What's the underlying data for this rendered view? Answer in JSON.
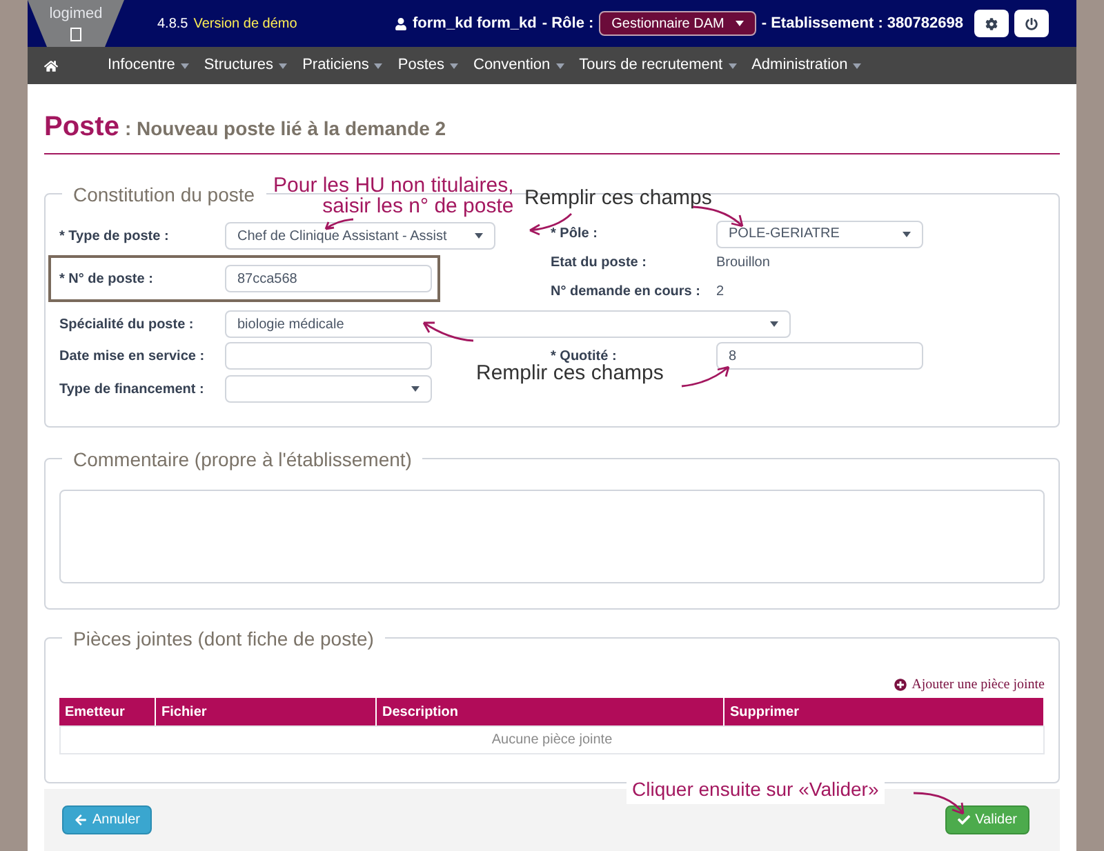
{
  "header": {
    "logo": "logimed",
    "version": "4.8.5",
    "edition": "Version de démo",
    "user": "form_kd form_kd",
    "role_label": "- Rôle :",
    "role": "Gestionnaire DAM",
    "establishment": "- Etablissement : 380782698"
  },
  "nav": [
    {
      "label": "Infocentre"
    },
    {
      "label": "Structures"
    },
    {
      "label": "Praticiens"
    },
    {
      "label": "Postes"
    },
    {
      "label": "Convention"
    },
    {
      "label": "Tours de recrutement"
    },
    {
      "label": "Administration"
    }
  ],
  "title": "Poste",
  "subtitle": ": Nouveau poste lié à la demande 2",
  "constitution": {
    "legend": "Constitution du poste",
    "left": [
      {
        "label": "* Type de poste :",
        "kind": "select",
        "value": "Chef de Clinique Assistant - Assist",
        "highlighted": false
      },
      {
        "label": "* N° de poste :",
        "kind": "input",
        "value": "87cca568",
        "highlighted": true
      }
    ],
    "right": [
      {
        "label": "* Pôle :",
        "kind": "select",
        "value": "POLE-GERIATRE"
      },
      {
        "label": "Etat du poste :",
        "kind": "text",
        "value": "Brouillon"
      },
      {
        "label": "N° demande en cours :",
        "kind": "text",
        "value": "2"
      }
    ],
    "speciality": {
      "label": "Spécialité du poste :",
      "value": "biologie médicale"
    },
    "left2": [
      {
        "label": "Date mise en service :",
        "kind": "input"
      },
      {
        "label": "Type de financement :",
        "kind": "select"
      }
    ],
    "quotity": {
      "label": "* Quotité :",
      "value": "8"
    }
  },
  "comment": {
    "legend": "Commentaire (propre à l'établissement)"
  },
  "attachments": {
    "legend": "Pièces jointes (dont fiche de poste)",
    "add": "Ajouter une pièce jointe",
    "columns": [
      "Emetteur",
      "Fichier",
      "Description",
      "Supprimer"
    ],
    "empty": "Aucune pièce jointe"
  },
  "buttons": {
    "cancel": "Annuler",
    "submit": "Valider"
  },
  "annotations": [
    "Pour les HU non titulaires,\nsaisir les n° de poste",
    "Remplir ces champs",
    "Remplir ces champs",
    "Cliquer ensuite sur «Valider»"
  ]
}
